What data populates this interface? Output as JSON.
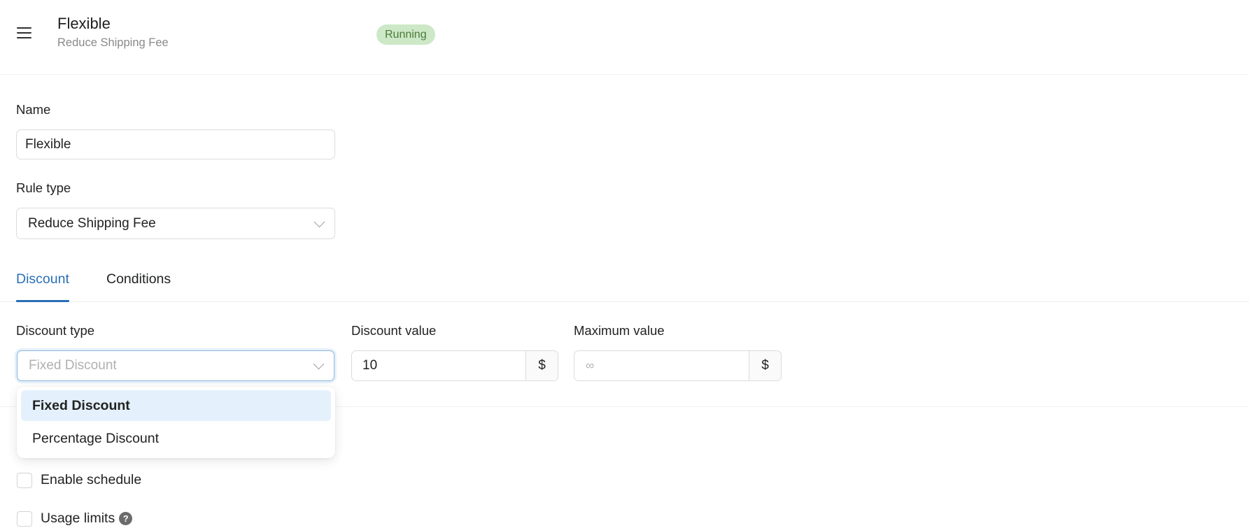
{
  "header": {
    "menu_icon": "hamburger-icon",
    "title": "Flexible",
    "subtitle": "Reduce Shipping Fee",
    "status_badge": "Running",
    "status_color": "#cde8c6"
  },
  "form": {
    "name": {
      "label": "Name",
      "value": "Flexible"
    },
    "rule_type": {
      "label": "Rule type",
      "value": "Reduce Shipping Fee"
    }
  },
  "tabs": [
    {
      "label": "Discount",
      "active": true
    },
    {
      "label": "Conditions",
      "active": false
    }
  ],
  "discount": {
    "type": {
      "label": "Discount type",
      "placeholder": "Fixed Discount",
      "options": [
        {
          "label": "Fixed Discount",
          "selected": true
        },
        {
          "label": "Percentage Discount",
          "selected": false
        }
      ]
    },
    "value": {
      "label": "Discount value",
      "value": "10",
      "suffix": "$"
    },
    "maximum": {
      "label": "Maximum value",
      "placeholder": "∞",
      "suffix": "$"
    }
  },
  "options": {
    "enable_schedule": {
      "label": "Enable schedule",
      "checked": false
    },
    "usage_limits": {
      "label": "Usage limits",
      "checked": false,
      "help": "?"
    }
  },
  "colors": {
    "accent": "#2a6fb5",
    "option_highlight": "#e4f1fc"
  }
}
